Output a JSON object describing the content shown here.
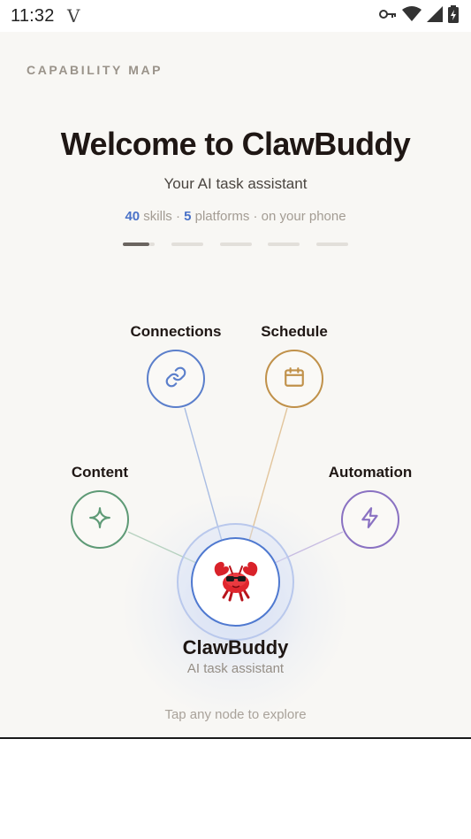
{
  "status_bar": {
    "time": "11:32",
    "badge": "V",
    "icons": [
      "key-icon",
      "wifi-icon",
      "signal-icon",
      "battery-icon"
    ]
  },
  "header": {
    "eyebrow": "CAPABILITY MAP",
    "title": "Welcome to ClawBuddy",
    "subtitle": "Your AI task assistant",
    "skills_count": "40",
    "skills_label": " skills · ",
    "platforms_count": "5",
    "platforms_label": " platforms · on your phone"
  },
  "pager": {
    "pages": 5,
    "active_index": 0
  },
  "nodes": {
    "connections": {
      "label": "Connections",
      "icon": "link-icon",
      "color": "#5b7fcb"
    },
    "schedule": {
      "label": "Schedule",
      "icon": "calendar-icon",
      "color": "#c0914a"
    },
    "content": {
      "label": "Content",
      "icon": "sparkle-icon",
      "color": "#5e9a76"
    },
    "automation": {
      "label": "Automation",
      "icon": "lightning-icon",
      "color": "#8a72c2"
    }
  },
  "center": {
    "title": "ClawBuddy",
    "subtitle": "AI task assistant",
    "icon": "crab-mascot-icon"
  },
  "hint": "Tap any node to explore",
  "colors": {
    "accent": "#4a72c8",
    "background": "#f8f7f4"
  }
}
